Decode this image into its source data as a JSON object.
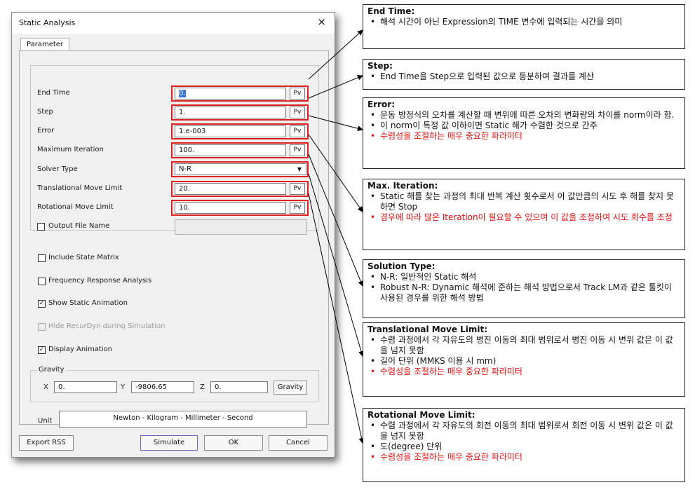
{
  "dialog": {
    "title": "Static Analysis",
    "close": "×",
    "tab": "Parameter",
    "fields": {
      "end_time": {
        "label": "End Time",
        "value": "0."
      },
      "step": {
        "label": "Step",
        "value": "1."
      },
      "error": {
        "label": "Error",
        "value": "1.e-003"
      },
      "max_iter": {
        "label": "Maximum Iteration",
        "value": "100."
      },
      "solver": {
        "label": "Solver Type",
        "value": "N-R"
      },
      "trans": {
        "label": "Translational Move Limit",
        "value": "20."
      },
      "rot": {
        "label": "Rotational Move Limit",
        "value": "10."
      },
      "output": {
        "label": "Output File Name",
        "value": ""
      }
    },
    "pv_label": "Pv",
    "checks": {
      "state_matrix": {
        "label": "Include State Matrix",
        "checked": false
      },
      "freq": {
        "label": "Frequency Response Analysis",
        "checked": false
      },
      "show_anim": {
        "label": "Show Static Animation",
        "checked": true
      },
      "hide_rd": {
        "label": "Hide RecurDyn during Simulation",
        "checked": false
      },
      "display_anim": {
        "label": "Display Animation",
        "checked": true
      }
    },
    "check_mark": "✓",
    "gravity": {
      "group": "Gravity",
      "x_label": "X",
      "x": "0.",
      "y_label": "Y",
      "y": "-9806.65",
      "z_label": "Z",
      "z": "0.",
      "button": "Gravity"
    },
    "unit": {
      "label": "Unit",
      "value": "Newton - Kilogram - Millimeter - Second"
    },
    "buttons": {
      "export": "Export RSS",
      "simulate": "Simulate",
      "ok": "OK",
      "cancel": "Cancel"
    }
  },
  "notes": [
    {
      "title": "End Time:",
      "items": [
        {
          "text": "해석 시간이 아닌 Expression의 TIME 변수에 입력되는 시간을 의미",
          "red": false
        }
      ]
    },
    {
      "title": "Step:",
      "items": [
        {
          "text": "End Time을 Step으로 입력된 값으로 등분하여 결과를 계산",
          "red": false
        }
      ]
    },
    {
      "title": "Error:",
      "items": [
        {
          "text": "운동 방정식의 오차를 계산할 때 변위에 따른 오차의 변화량의 차이를 norm이라 함.",
          "red": false
        },
        {
          "text": "이 norm이 특정 값 이하이면 Static 해가 수렴한 것으로 간주",
          "red": false
        },
        {
          "text": "수렴성을 조절하는 매우 중요한 파라미터",
          "red": true
        }
      ]
    },
    {
      "title": "Max. Iteration:",
      "items": [
        {
          "text": "Static 해를 찾는 과정의 최대 반복 계산 횟수로서 이 값만큼의 시도 후 해를 찾지 못하면 Stop",
          "red": false
        },
        {
          "text": "경우에 따라 많은 Iteration이 필요할 수 있으며 이 값을 조정하여 시도 회수를 조정",
          "red": true
        }
      ]
    },
    {
      "title": "Solution Type:",
      "items": [
        {
          "text": "N-R: 일반적인 Static 해석",
          "red": false
        },
        {
          "text": "Robust N-R: Dynamic 해석에 준하는 해석 방법으로서 Track LM과 같은 툴킷이 사용된 경우를 위한 해석 방법",
          "red": false
        }
      ]
    },
    {
      "title": "Translational Move Limit:",
      "items": [
        {
          "text": "수렴 과정에서 각 자유도의 병진 이동의 최대 범위로서 병진 이동 시 변위 값은 이 값을 넘지 못함",
          "red": false
        },
        {
          "text": "길이 단위 (MMKS 이용 시 mm)",
          "red": false
        },
        {
          "text": "수렴성을 조절하는 매우 중요한 파라미터",
          "red": true
        }
      ]
    },
    {
      "title": "Rotational Move Limit:",
      "items": [
        {
          "text": "수렴 과정에서 각 자유도의 회전 이동의 최대 범위로서 회전 이동 시 변위 값은 이 값을 넘지 못함",
          "red": false
        },
        {
          "text": "도(degree) 단위",
          "red": false
        },
        {
          "text": "수렴성을 조절하는 매우 중요한 파라미터",
          "red": true
        }
      ]
    }
  ],
  "colors": {
    "highlight": "#e02020",
    "red_text": "#e01010"
  }
}
